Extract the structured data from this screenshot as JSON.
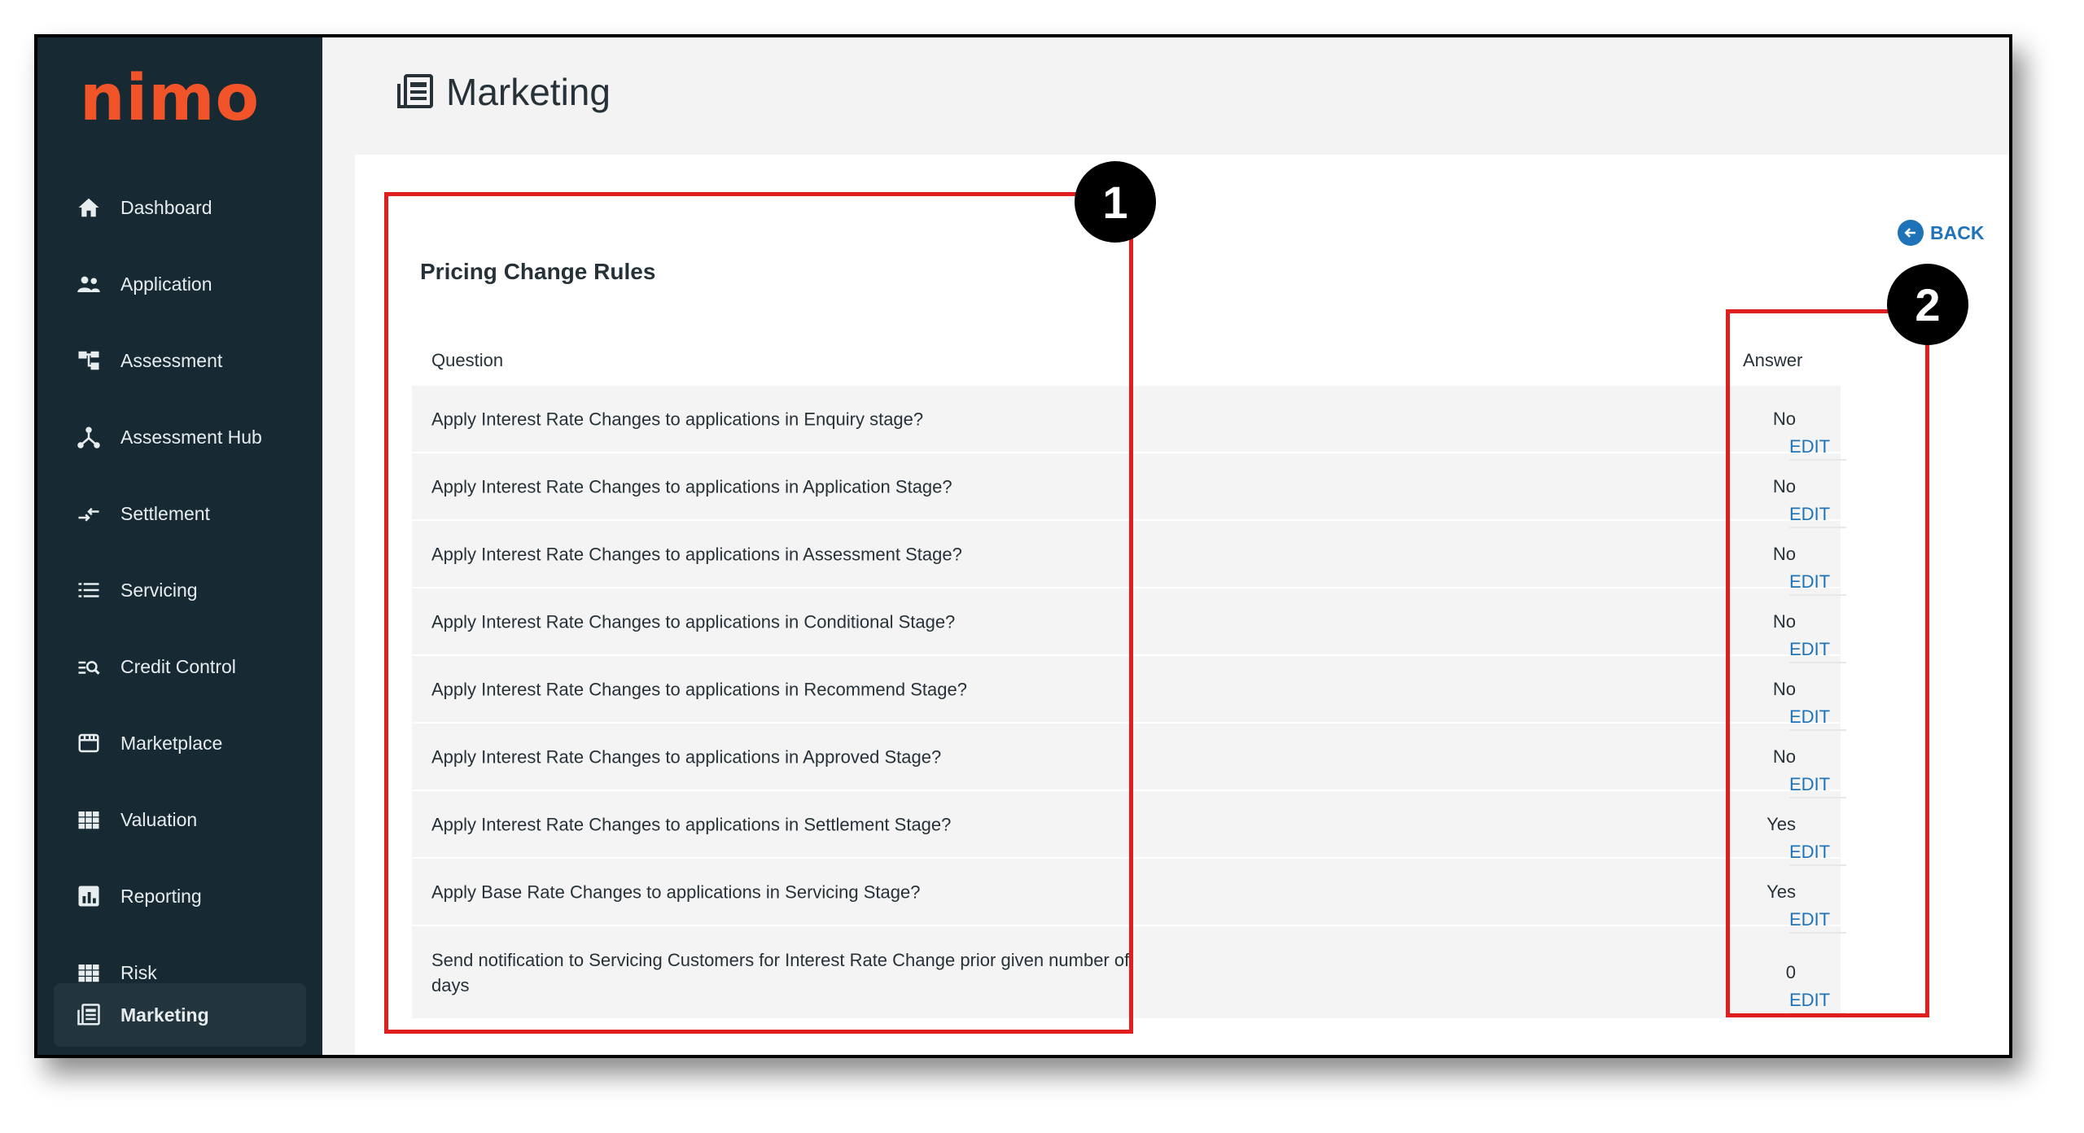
{
  "app": {
    "logo": "nimo",
    "page_title": "Marketing"
  },
  "sidebar": {
    "items": [
      {
        "label": "Dashboard",
        "icon": "home-icon"
      },
      {
        "label": "Application",
        "icon": "people-icon"
      },
      {
        "label": "Assessment",
        "icon": "hierarchy-icon"
      },
      {
        "label": "Assessment Hub",
        "icon": "hub-icon"
      },
      {
        "label": "Settlement",
        "icon": "transfer-icon"
      },
      {
        "label": "Servicing",
        "icon": "list-icon"
      },
      {
        "label": "Credit Control",
        "icon": "search-list-icon"
      },
      {
        "label": "Marketplace",
        "icon": "store-icon"
      },
      {
        "label": "Valuation",
        "icon": "grid-icon"
      },
      {
        "label": "Reporting",
        "icon": "bar-chart-icon"
      },
      {
        "label": "Risk",
        "icon": "grid-icon"
      },
      {
        "label": "Marketing",
        "icon": "newspaper-icon",
        "active": true
      }
    ]
  },
  "main": {
    "back_label": "BACK",
    "section_title": "Pricing Change Rules",
    "columns": {
      "question": "Question",
      "answer": "Answer"
    },
    "edit_label": "EDIT",
    "rows": [
      {
        "question": "Apply Interest Rate Changes to applications in Enquiry stage?",
        "answer": "No"
      },
      {
        "question": "Apply Interest Rate Changes to applications in Application Stage?",
        "answer": "No"
      },
      {
        "question": "Apply Interest Rate Changes to applications in Assessment Stage?",
        "answer": "No"
      },
      {
        "question": "Apply Interest Rate Changes to applications in Conditional Stage?",
        "answer": "No"
      },
      {
        "question": "Apply Interest Rate Changes to applications in Recommend Stage?",
        "answer": "No"
      },
      {
        "question": "Apply Interest Rate Changes to applications in Approved Stage?",
        "answer": "No"
      },
      {
        "question": "Apply Interest Rate Changes to applications in Settlement Stage?",
        "answer": "Yes"
      },
      {
        "question": "Apply Base Rate Changes to applications in Servicing Stage?",
        "answer": "Yes"
      },
      {
        "question": "Send notification to Servicing Customers for Interest Rate Change prior given number of days",
        "answer": "0"
      }
    ]
  },
  "annotations": {
    "callout_1": "1",
    "callout_2": "2",
    "box_color": "#e01e1e"
  },
  "colors": {
    "sidebar_bg": "#172a33",
    "logo": "#f2542a",
    "link": "#1e73b8"
  }
}
